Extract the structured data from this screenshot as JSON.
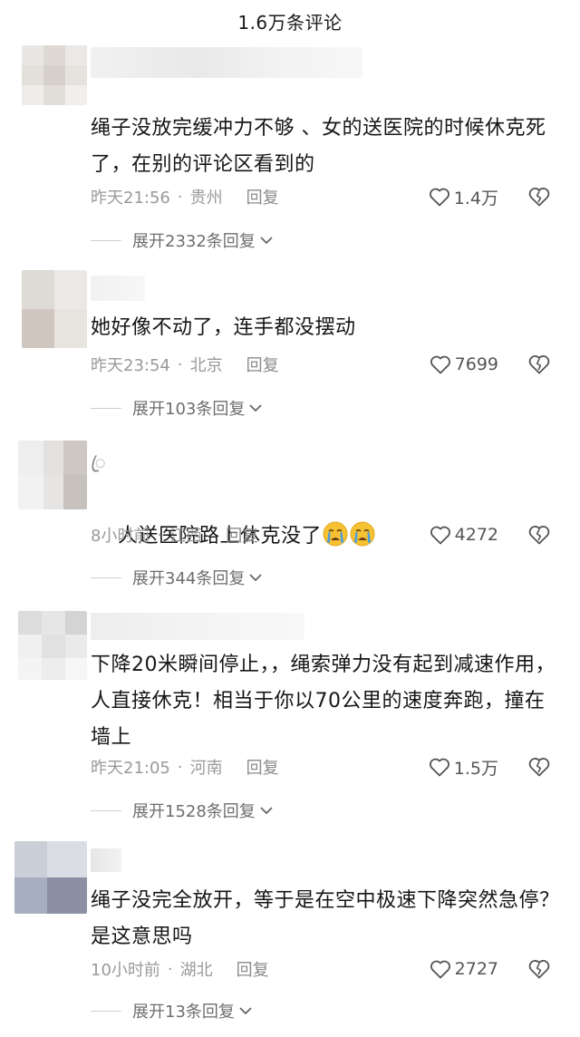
{
  "header": {
    "title": "1.6万条评论"
  },
  "comments": [
    {
      "text": "绳子没放完缓冲力不够 、女的送医院的时候休克死了，在别的评论区看到的",
      "time": "昨天21:56",
      "location": "贵州",
      "reply_label": "回复",
      "likes": "1.4万",
      "expand_label": "展开2332条回复"
    },
    {
      "text": "她好像不动了，连手都没摆动",
      "time": "昨天23:54",
      "location": "北京",
      "reply_label": "回复",
      "likes": "7699",
      "expand_label": "展开103条回复"
    },
    {
      "username": "ꦿ",
      "text": "人送医院路上休克没了",
      "time": "8小时前",
      "location": "江西",
      "reply_label": "回复",
      "likes": "4272",
      "expand_label": "展开344条回复"
    },
    {
      "text": "下降20米瞬间停止，，绳索弹力没有起到减速作用，人直接休克！相当于你以70公里的速度奔跑，撞在墙上",
      "time": "昨天21:05",
      "location": "河南",
      "reply_label": "回复",
      "likes": "1.5万",
      "expand_label": "展开1528条回复"
    },
    {
      "text": "绳子没完全放开，等于是在空中极速下降突然急停？ 是这意思吗",
      "time": "10小时前",
      "location": "湖北",
      "reply_label": "回复",
      "likes": "2727",
      "expand_label": "展开13条回复"
    }
  ],
  "meta_separator": "·",
  "icons": {
    "like": "heart-outline-icon",
    "dislike": "broken-heart-outline-icon",
    "expand": "chevron-down-icon",
    "emoji": "crying-face-emoji"
  },
  "colors": {
    "text": "#161616",
    "meta": "#9a9a9a",
    "emoji_face": "#f6c232",
    "emoji_tear": "#4a9fe0"
  }
}
